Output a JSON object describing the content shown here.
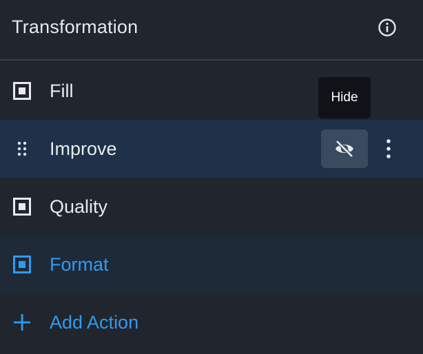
{
  "header": {
    "title": "Transformation",
    "info_icon": "info-icon"
  },
  "rows": {
    "fill": {
      "label": "Fill",
      "icon": "square-target-icon"
    },
    "improve": {
      "label": "Improve",
      "icon": "drag-handle-icon",
      "hidden_toggle_icon": "eye-slash-icon",
      "more_icon": "more-vertical-icon"
    },
    "quality": {
      "label": "Quality",
      "icon": "square-target-icon"
    },
    "format": {
      "label": "Format",
      "icon": "square-target-icon"
    },
    "add": {
      "label": "Add Action",
      "icon": "plus-icon"
    }
  },
  "tooltip": {
    "text": "Hide"
  },
  "colors": {
    "accent": "#2f9bf0",
    "selected_row": "#1e3149",
    "panel_bg": "#20242c"
  }
}
